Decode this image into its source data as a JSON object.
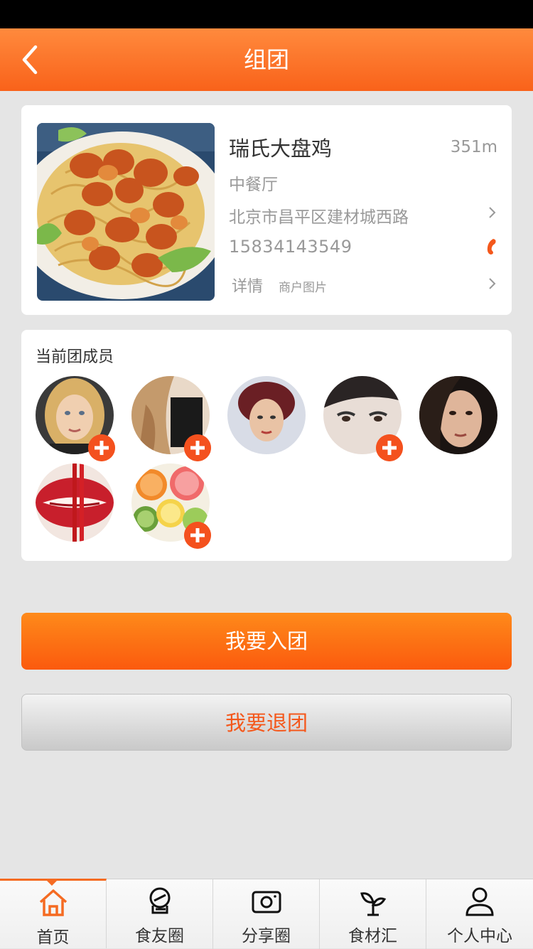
{
  "nav": {
    "title": "组团"
  },
  "shop": {
    "name": "瑞氏大盘鸡",
    "distance": "351m",
    "type": "中餐厅",
    "address": "北京市昌平区建材城西路",
    "phone": "15834143549",
    "detail_label": "详情",
    "photos_label": "商户图片"
  },
  "members": {
    "title": "当前团成员",
    "items": [
      {
        "name": "member-1",
        "addable": true
      },
      {
        "name": "member-2",
        "addable": true
      },
      {
        "name": "member-3",
        "addable": false
      },
      {
        "name": "member-4",
        "addable": true
      },
      {
        "name": "member-5",
        "addable": false
      },
      {
        "name": "member-6",
        "addable": false
      },
      {
        "name": "member-7",
        "addable": true
      }
    ]
  },
  "actions": {
    "join_label": "我要入团",
    "quit_label": "我要退团"
  },
  "tabs": [
    {
      "label": "首页",
      "icon": "home-icon",
      "active": true
    },
    {
      "label": "食友圈",
      "icon": "chef-hat-icon",
      "active": false
    },
    {
      "label": "分享圈",
      "icon": "camera-icon",
      "active": false
    },
    {
      "label": "食材汇",
      "icon": "sprout-icon",
      "active": false
    },
    {
      "label": "个人中心",
      "icon": "person-icon",
      "active": false
    }
  ],
  "colors": {
    "accent": "#f9621a",
    "plus": "#f4511e",
    "quit_text": "#f4581c"
  }
}
